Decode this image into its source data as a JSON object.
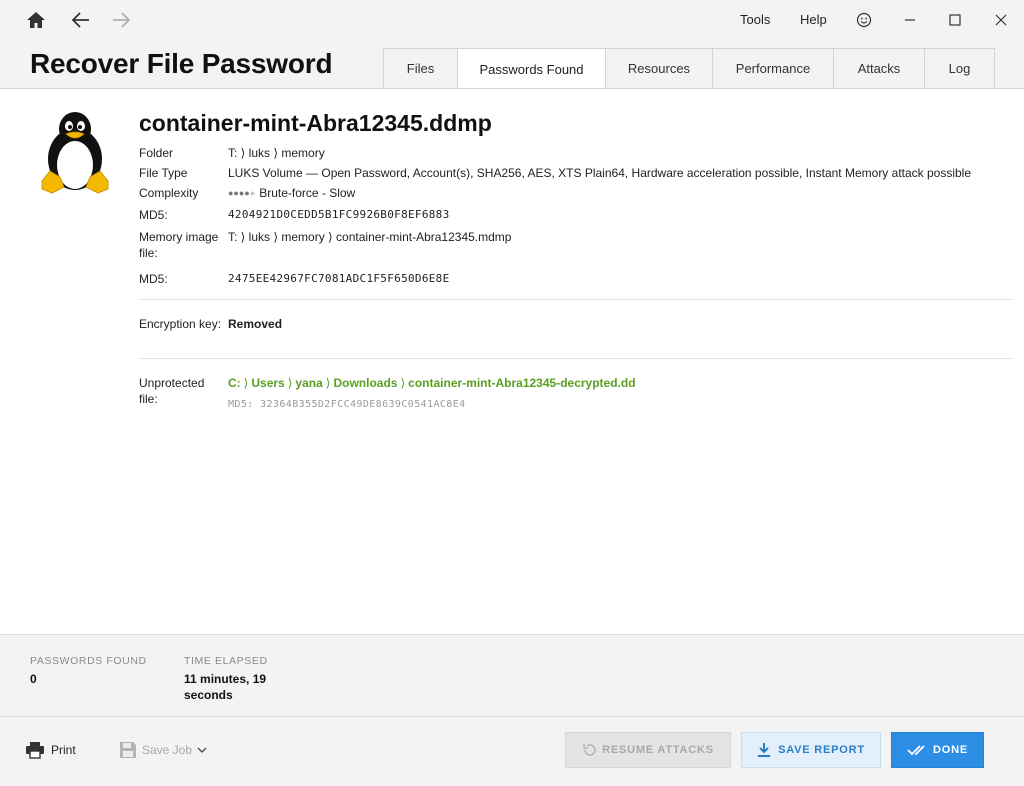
{
  "titlebar": {
    "menu": {
      "tools": "Tools",
      "help": "Help"
    }
  },
  "app_title": "Recover File Password",
  "tabs": [
    {
      "label": "Files",
      "active": false
    },
    {
      "label": "Passwords Found",
      "active": true
    },
    {
      "label": "Resources",
      "active": false
    },
    {
      "label": "Performance",
      "active": false
    },
    {
      "label": "Attacks",
      "active": false
    },
    {
      "label": "Log",
      "active": false
    }
  ],
  "file": {
    "icon": "tux-penguin-icon",
    "name": "container-mint-Abra12345.ddmp",
    "folder_label": "Folder",
    "folder_value": "T: ⟩ luks ⟩ memory",
    "filetype_label": "File Type",
    "filetype_value": "LUKS Volume — Open Password, Account(s), SHA256, AES, XTS Plain64, Hardware acceleration possible, Instant Memory attack possible",
    "complexity_label": "Complexity",
    "complexity_level": 4,
    "complexity_max": 5,
    "complexity_value": "Brute-force - Slow",
    "md5_label": "MD5:",
    "md5_value": "4204921D0CEDD5B1FC9926B0F8EF6883",
    "memory_label": "Memory image file:",
    "memory_value": "T: ⟩ luks ⟩ memory ⟩ container-mint-Abra12345.mdmp",
    "md5b_label": "MD5:",
    "md5b_value": "2475EE42967FC7081ADC1F5F650D6E8E",
    "key_label": "Encryption key:",
    "key_value": "Removed",
    "unprotected_label": "Unprotected file:",
    "unprotected_path": [
      "C:",
      "Users",
      "yana",
      "Downloads",
      "container-mint-Abra12345-decrypted.dd"
    ],
    "unprotected_md5": "MD5: 32364B355D2FCC49DE8639C0541AC8E4"
  },
  "stats": {
    "passwords_found_label": "PASSWORDS FOUND",
    "passwords_found_value": "0",
    "time_elapsed_label": "TIME ELAPSED",
    "time_elapsed_value": "11 minutes, 19 seconds"
  },
  "footer": {
    "print_label": "Print",
    "save_job_label": "Save Job",
    "resume_label": "RESUME ATTACKS",
    "save_report_label": "SAVE REPORT",
    "done_label": "DONE"
  },
  "colors": {
    "accent": "#2d8ee6",
    "path_green": "#5aa020",
    "disabled": "#a8a8a8"
  }
}
